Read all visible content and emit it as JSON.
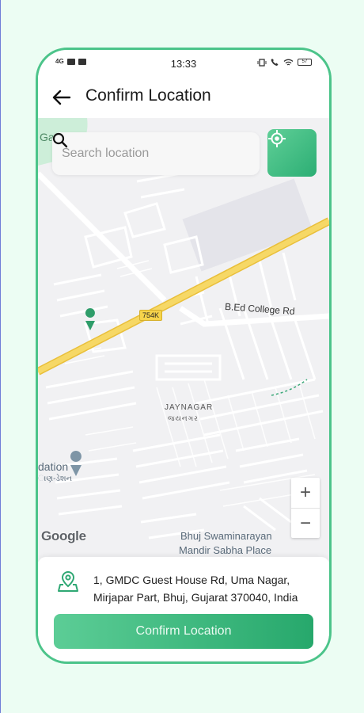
{
  "status_bar": {
    "network": "4G",
    "time": "13:33",
    "battery": "57"
  },
  "header": {
    "title": "Confirm Location"
  },
  "search": {
    "placeholder": "Search location",
    "value": ""
  },
  "map": {
    "labels": {
      "road_bed_college": "B.Ed College Rd",
      "highway_shield": "754K",
      "area_jaynagar_en": "JAYNAGAR",
      "area_jaynagar_gu": "જયનગર",
      "place_station": "dation",
      "place_station_gu": "ાણ-ડેશન",
      "place_swaminarayan_1": "Bhuj Swaminarayan",
      "place_swaminarayan_2": "Mandir Sabha Place",
      "top_left": "Ga"
    },
    "zoom_in": "+",
    "zoom_out": "−",
    "attribution": "Google"
  },
  "address": {
    "text": "1, GMDC Guest House Rd, Uma Nagar, Mirjapar Part, Bhuj, Gujarat 370040, India"
  },
  "actions": {
    "confirm_label": "Confirm Location"
  },
  "colors": {
    "accent": "#3dbd82",
    "accent_dark": "#27a86c",
    "frame": "#4cc48a",
    "highway": "#f3cf55"
  },
  "icons": {
    "back": "arrow-left-icon",
    "search": "search-icon",
    "locate": "crosshair-icon",
    "address": "location-pin-icon"
  }
}
